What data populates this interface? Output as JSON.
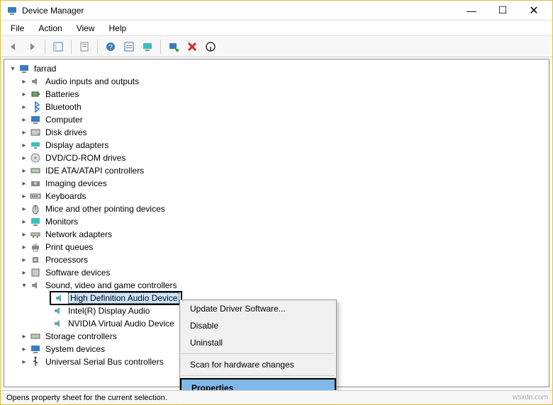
{
  "window": {
    "title": "Device Manager"
  },
  "menus": {
    "file": "File",
    "action": "Action",
    "view": "View",
    "help": "Help"
  },
  "root": "farrad",
  "nodes": {
    "audio_io": "Audio inputs and outputs",
    "batteries": "Batteries",
    "bluetooth": "Bluetooth",
    "computer": "Computer",
    "disk": "Disk drives",
    "display": "Display adapters",
    "dvd": "DVD/CD-ROM drives",
    "ide": "IDE ATA/ATAPI controllers",
    "imaging": "Imaging devices",
    "keyboards": "Keyboards",
    "mice": "Mice and other pointing devices",
    "monitors": "Monitors",
    "network": "Network adapters",
    "printq": "Print queues",
    "processors": "Processors",
    "software": "Software devices",
    "sound": "Sound, video and game controllers",
    "hda": "High Definition Audio Device",
    "intel_audio": "Intel(R) Display Audio",
    "nvidia_audio": "NVIDIA Virtual Audio Device",
    "storage": "Storage controllers",
    "system": "System devices",
    "usb": "Universal Serial Bus controllers"
  },
  "context": {
    "update": "Update Driver Software...",
    "disable": "Disable",
    "uninstall": "Uninstall",
    "scan": "Scan for hardware changes",
    "properties": "Properties"
  },
  "status": "Opens property sheet for the current selection.",
  "watermark": "wsxdn.com"
}
